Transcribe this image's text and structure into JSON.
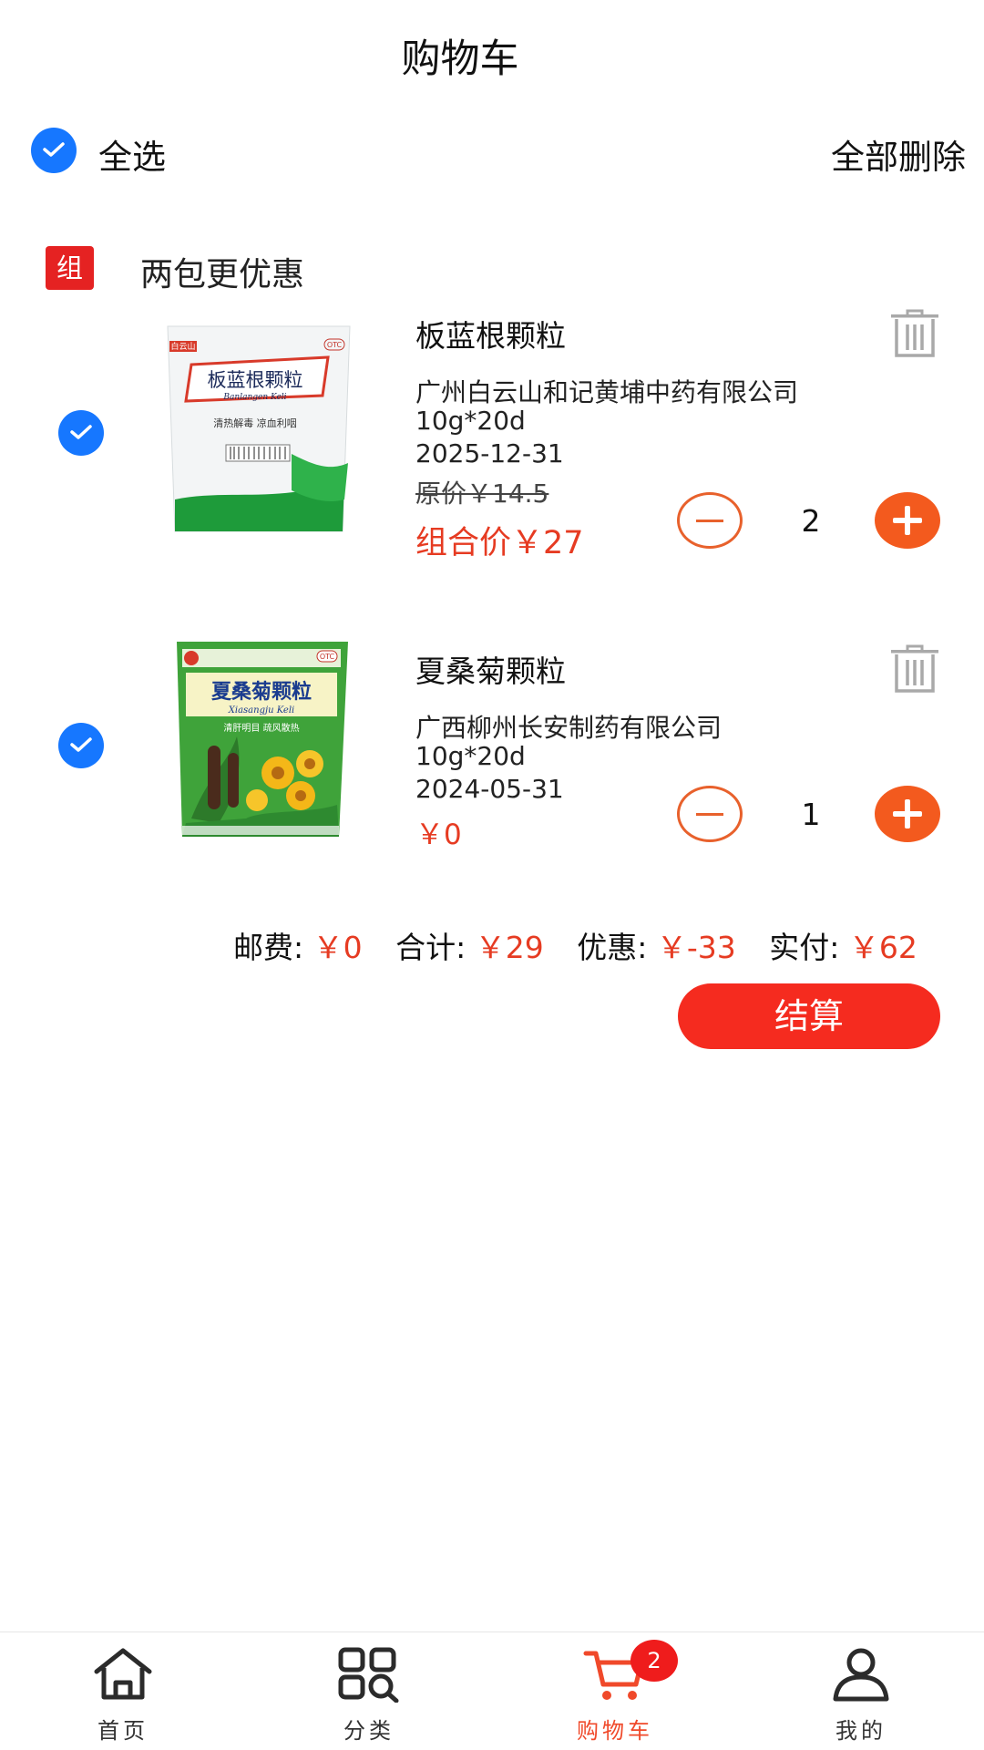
{
  "header": {
    "title": "购物车"
  },
  "toolbar": {
    "select_all_label": "全选",
    "delete_all_label": "全部删除"
  },
  "combo": {
    "badge": "组合",
    "title": "两包更优惠"
  },
  "items": [
    {
      "name": "板蓝根颗粒",
      "manufacturer": "广州白云山和记黄埔中药有限公司",
      "spec": "10g*20d",
      "expiry": "2025-12-31",
      "original_price": "原价￥14.5",
      "price": "组合价￥27",
      "quantity": "2",
      "checked": true,
      "package_brand": "白云山",
      "package_name": "板蓝根颗粒",
      "package_pinyin": "Banlangen Keli",
      "package_claims": "清热解毒 凉血利咽",
      "package_badge": "OTC",
      "package_color": "#1e9b3a"
    },
    {
      "name": "夏桑菊颗粒",
      "manufacturer": "广西柳州长安制药有限公司",
      "spec": "10g*20d",
      "expiry": "2024-05-31",
      "price": "￥0",
      "quantity": "1",
      "checked": true,
      "package_name": "夏桑菊颗粒",
      "package_pinyin": "Xiasangju Keli",
      "package_claims": "清肝明目 疏风散热",
      "package_badge": "OTC",
      "package_color": "#3fa33a"
    }
  ],
  "summary": {
    "shipping_label": "邮费:",
    "shipping_value": "￥0",
    "total_label": "合计:",
    "total_value": "￥29",
    "discount_label": "优惠:",
    "discount_value": "￥-33",
    "paid_label": "实付:",
    "paid_value": "￥62",
    "checkout_label": "结算"
  },
  "tabbar": {
    "tabs": [
      {
        "label": "首页",
        "icon": "home-icon"
      },
      {
        "label": "分类",
        "icon": "category-search-icon"
      },
      {
        "label": "购物车",
        "icon": "cart-icon",
        "active": true,
        "badge": "2"
      },
      {
        "label": "我的",
        "icon": "user-icon"
      }
    ]
  },
  "colors": {
    "accent_blue": "#1677ff",
    "price_red": "#e63b22",
    "checkout_red": "#f52b1f",
    "stepper_orange": "#f35a1e"
  }
}
